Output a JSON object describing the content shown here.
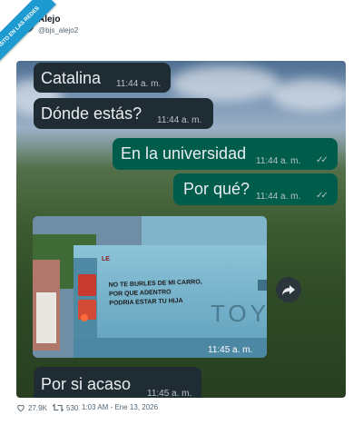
{
  "watermark": "VISTO EN LAS REDES",
  "author": {
    "name": "Alejo",
    "handle": "@bjs_alejo2"
  },
  "chat": {
    "messages": [
      {
        "side": "in",
        "text": "Catalina",
        "time": "11:44 a. m."
      },
      {
        "side": "in",
        "text": "Dónde estás?",
        "time": "11:44 a. m."
      },
      {
        "side": "out",
        "text": "En la universidad",
        "time": "11:44 a. m.",
        "status": "read"
      },
      {
        "side": "out",
        "text": "Por qué?",
        "time": "11:44 a. m.",
        "status": "read"
      },
      {
        "side": "in",
        "type": "image",
        "time": "11:45 a. m."
      },
      {
        "side": "in",
        "text": "Por si acaso",
        "time": "11:45 a. m."
      }
    ],
    "truck_text": {
      "line1": "NO TE BURLES DE MI CARRO,",
      "line2": "POR QUE ADENTRO",
      "line3": "PODRIA ESTAR TU HIJA",
      "brand": "TOY",
      "plate": "LE"
    },
    "share_icon": "share-arrow-icon",
    "read_ticks": "✓✓"
  },
  "footer": {
    "likes": "27.9K",
    "retweets": "530",
    "timestamp": "1:03 AM - Ene 13, 2026"
  },
  "colors": {
    "incoming": "#202c33",
    "outgoing": "#005c4b",
    "ribbon": "#1d9bd1"
  }
}
